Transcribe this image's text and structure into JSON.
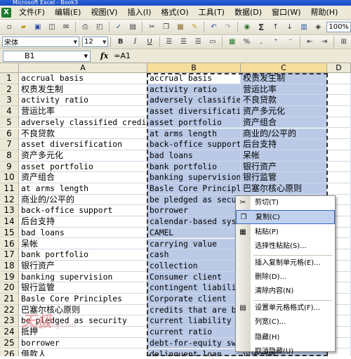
{
  "window": {
    "title": "Microsoft Excel - Book3"
  },
  "menu": [
    "文件(F)",
    "编辑(E)",
    "视图(V)",
    "插入(I)",
    "格式(O)",
    "工具(T)",
    "数据(D)",
    "窗口(W)",
    "帮助(H)"
  ],
  "toolbar": {
    "zoom": "100%",
    "font": "宋体",
    "size": "12",
    "bold": "B",
    "italic": "I",
    "underline": "U",
    "sigma": "Σ",
    "percent": "%"
  },
  "formula_bar": {
    "name_box": "B1",
    "fx": "fx",
    "formula": "=A1"
  },
  "columns": [
    "A",
    "B",
    "C",
    "D"
  ],
  "rows": [
    {
      "n": "1",
      "a": "accrual basis",
      "b": "accrual basis",
      "c": "权责发生制"
    },
    {
      "n": "2",
      "a": "权责发生制",
      "b": "activity ratio",
      "c": "营运比率"
    },
    {
      "n": "3",
      "a": "activity ratio",
      "b": "adversely classified",
      "c": "不良贷款"
    },
    {
      "n": "4",
      "a": "营运比率",
      "b": "asset diversification",
      "c": "资产多元化"
    },
    {
      "n": "5",
      "a": "adversely classified credit",
      "b": "asset portfolio",
      "c": "资产组合"
    },
    {
      "n": "6",
      "a": "不良贷款",
      "b": "at arms length",
      "c": "商业的/公平的"
    },
    {
      "n": "7",
      "a": "asset diversification",
      "b": "back-office support",
      "c": "后台支持"
    },
    {
      "n": "8",
      "a": "资产多元化",
      "b": "bad loans",
      "c": "呆帐"
    },
    {
      "n": "9",
      "a": "asset portfolio",
      "b": "bank portfolio",
      "c": "银行资产"
    },
    {
      "n": "10",
      "a": "资产组合",
      "b": "banking supervision",
      "c": "银行监管"
    },
    {
      "n": "11",
      "a": "at arms length",
      "b": "Basle Core Principles",
      "c": "巴塞尔核心原则"
    },
    {
      "n": "12",
      "a": "商业的/公平的",
      "b": "be pledged as secur",
      "c": ""
    },
    {
      "n": "13",
      "a": "back-office support",
      "b": "borrower",
      "c": ""
    },
    {
      "n": "14",
      "a": "后台支持",
      "b": "calendar-based syst",
      "c": "度"
    },
    {
      "n": "15",
      "a": "bad loans",
      "b": "CAMEL",
      "c": ""
    },
    {
      "n": "16",
      "a": "呆帐",
      "b": "carrying value",
      "c": ""
    },
    {
      "n": "17",
      "a": "bank portfolio",
      "b": "cash",
      "c": ""
    },
    {
      "n": "18",
      "a": "银行资产",
      "b": "collection",
      "c": ""
    },
    {
      "n": "19",
      "a": "banking supervision",
      "b": "Consumer client",
      "c": ""
    },
    {
      "n": "20",
      "a": "银行监管",
      "b": "contingent liabilit",
      "c": ""
    },
    {
      "n": "21",
      "a": "Basle Core Principles",
      "b": "Corporate client",
      "c": ""
    },
    {
      "n": "22",
      "a": "巴塞尔核心原则",
      "b": "credits that are be",
      "c": ""
    },
    {
      "n": "23",
      "a": "be pledged as security",
      "b": "current liability a",
      "c": ""
    },
    {
      "n": "24",
      "a": "抵押",
      "b": "current ratio",
      "c": ""
    },
    {
      "n": "25",
      "a": "borrower",
      "b": "debt-for-equity swa",
      "c": ""
    },
    {
      "n": "26",
      "a": "借款人",
      "b": "delinquent loan",
      "c": "过失贷款"
    }
  ],
  "context_menu": {
    "items": [
      {
        "label": "剪切(T)",
        "icon": "scissors-icon"
      },
      {
        "label": "复制(C)",
        "icon": "copy-icon",
        "highlighted": true
      },
      {
        "label": "粘贴(P)",
        "icon": "paste-icon"
      },
      {
        "label": "选择性粘贴(S)...",
        "icon": ""
      },
      {
        "label": "插入复制单元格(E)...",
        "icon": ""
      },
      {
        "label": "删除(D)...",
        "icon": ""
      },
      {
        "label": "清除内容(N)",
        "icon": ""
      },
      {
        "label": "设置单元格格式(F)...",
        "icon": "format-cells-icon"
      },
      {
        "label": "列宽(C)...",
        "icon": ""
      },
      {
        "label": "隐藏(H)",
        "icon": ""
      },
      {
        "label": "取消隐藏(U)",
        "icon": ""
      }
    ]
  },
  "watermark": {
    "text": "天极",
    "sub": "www.yesky.com"
  }
}
